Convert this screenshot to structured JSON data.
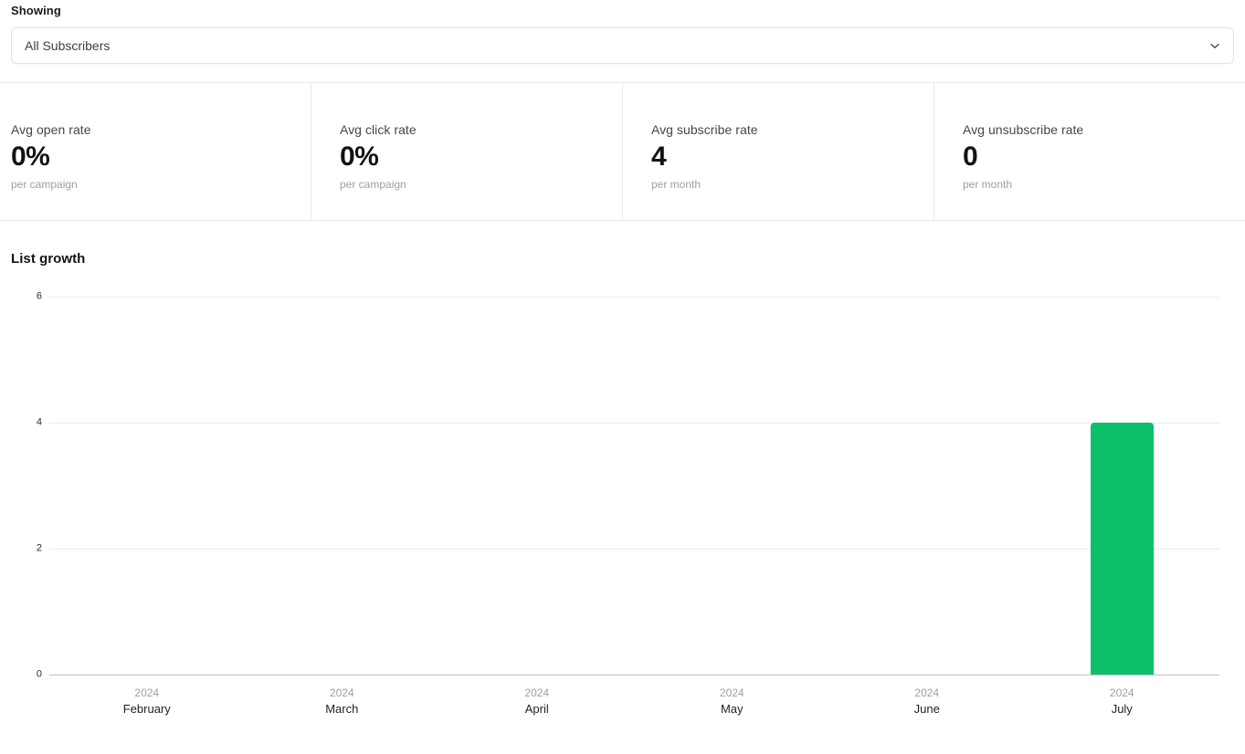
{
  "filter": {
    "label": "Showing",
    "selected": "All Subscribers",
    "chevron_icon": "chevron-down-icon"
  },
  "stats": [
    {
      "title": "Avg open rate",
      "value": "0%",
      "sub": "per campaign"
    },
    {
      "title": "Avg click rate",
      "value": "0%",
      "sub": "per campaign"
    },
    {
      "title": "Avg subscribe rate",
      "value": "4",
      "sub": "per month"
    },
    {
      "title": "Avg unsubscribe rate",
      "value": "0",
      "sub": "per month"
    }
  ],
  "chart_data": {
    "type": "bar",
    "title": "List growth",
    "xlabel": "",
    "ylabel": "",
    "ylim": [
      0,
      6
    ],
    "yticks": [
      "0",
      "2",
      "4",
      "6"
    ],
    "grid": true,
    "legend": false,
    "categories": [
      "February",
      "March",
      "April",
      "May",
      "June",
      "July"
    ],
    "category_years": [
      "2024",
      "2024",
      "2024",
      "2024",
      "2024",
      "2024"
    ],
    "values": [
      0,
      0,
      0,
      0,
      0,
      4
    ],
    "bar_color": "#0fc06a"
  }
}
